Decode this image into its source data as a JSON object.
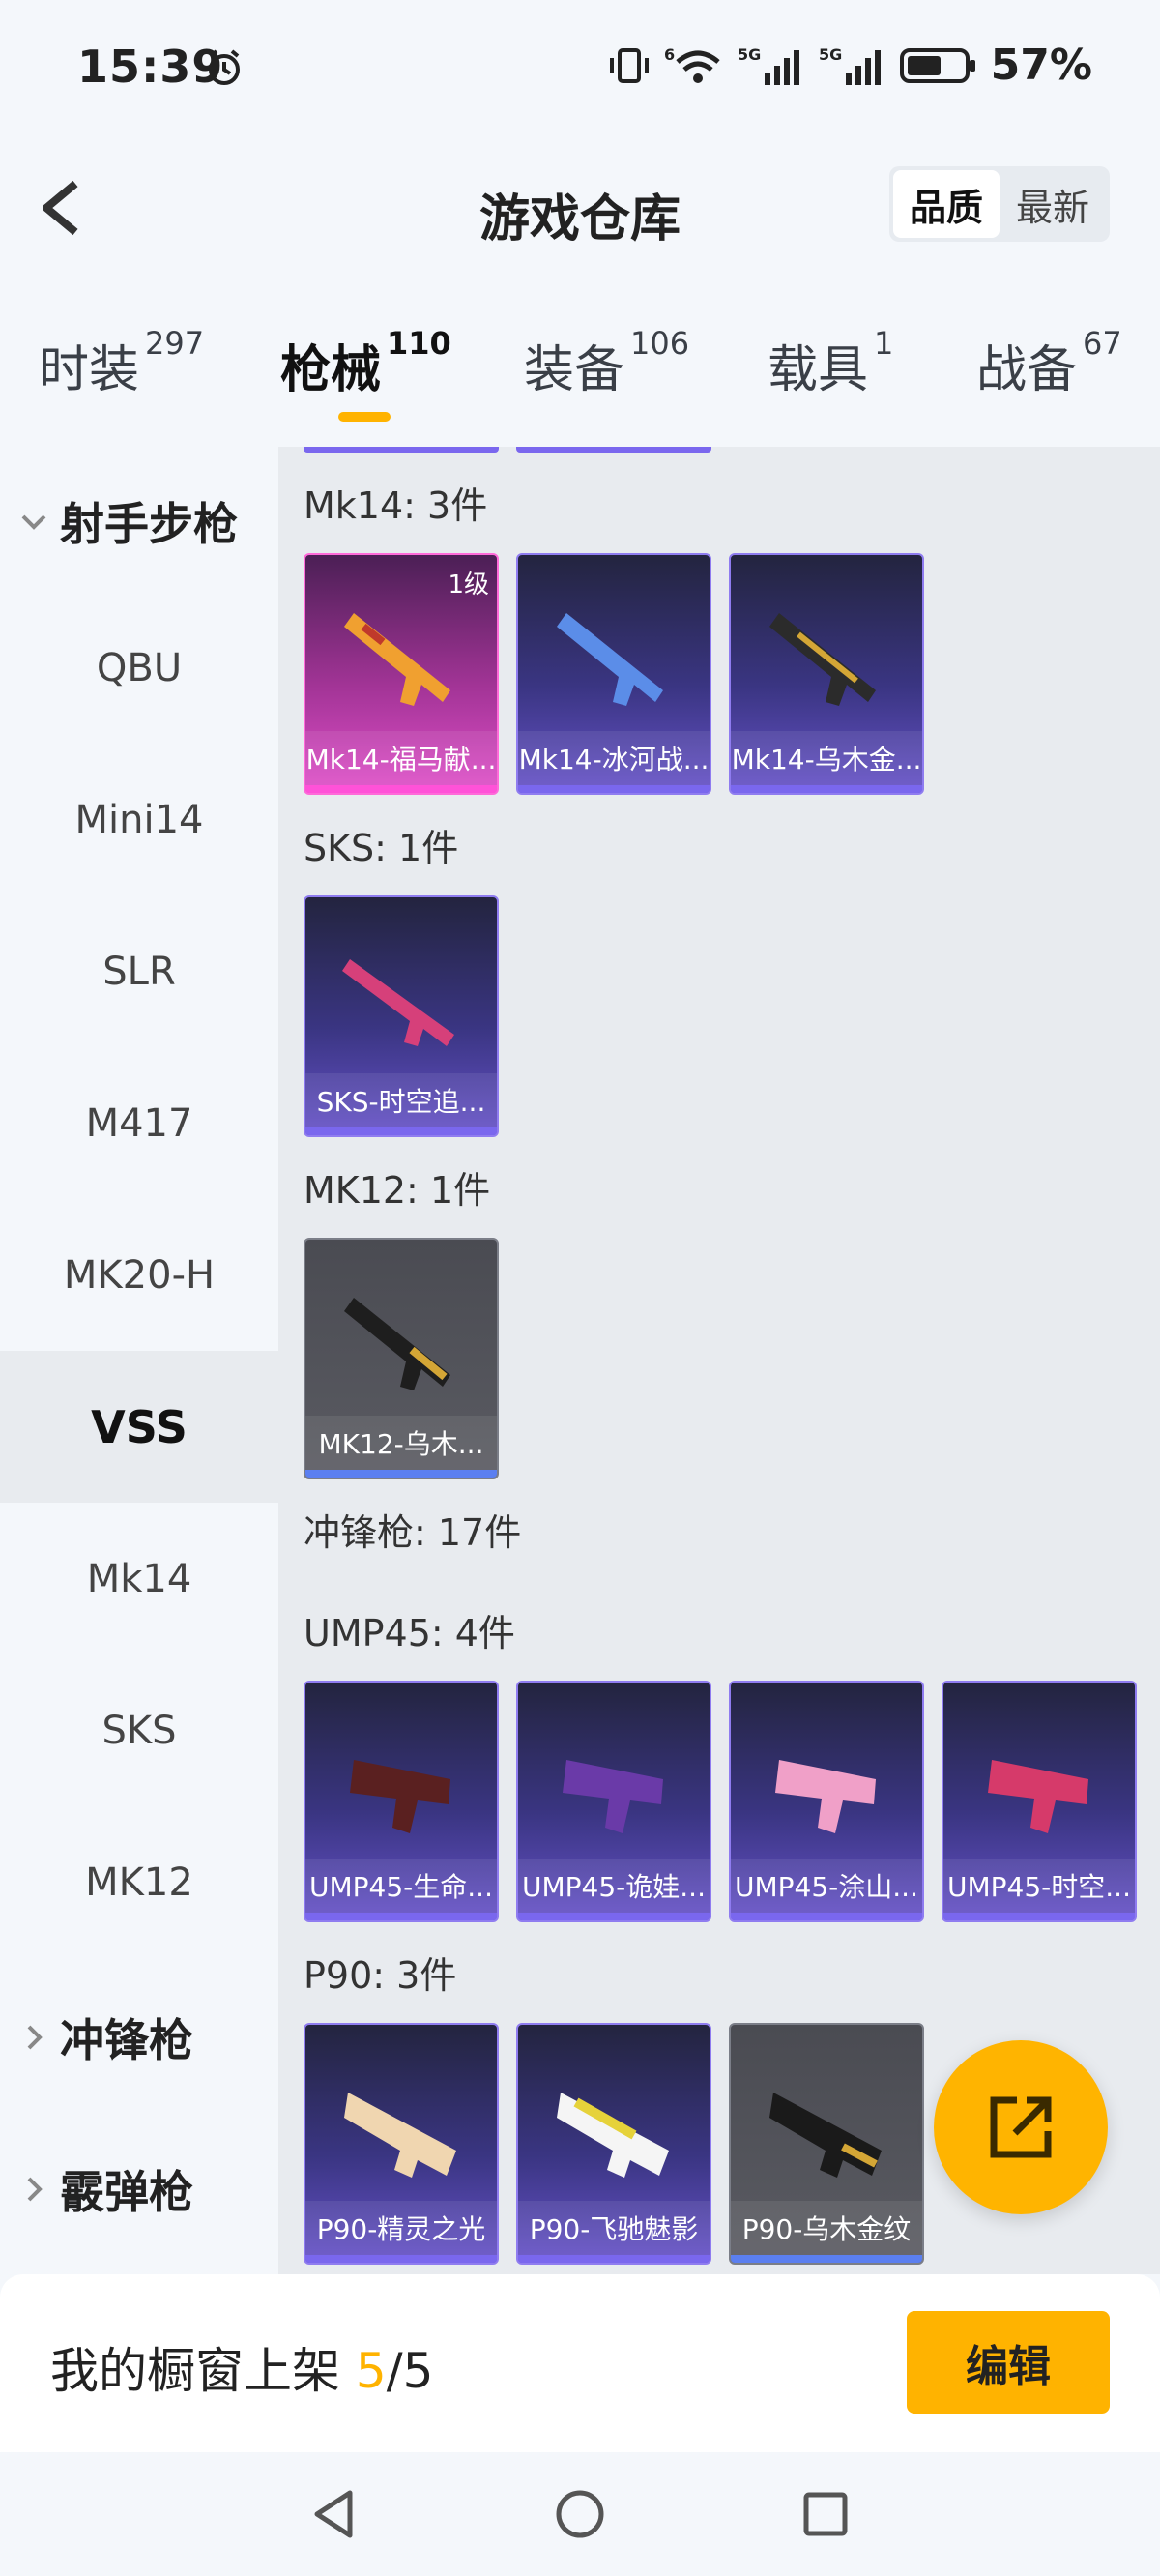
{
  "status_bar": {
    "time": "15:39",
    "network_left": "6",
    "network_5g_1": "5G",
    "network_5g_2": "5G",
    "battery": "57%"
  },
  "header": {
    "title": "游戏仓库",
    "sort_options": [
      "品质",
      "最新"
    ],
    "sort_selected": "品质"
  },
  "tabs": [
    {
      "label": "时装",
      "count": "297"
    },
    {
      "label": "枪械",
      "count": "110",
      "active": true
    },
    {
      "label": "装备",
      "count": "106"
    },
    {
      "label": "载具",
      "count": "1"
    },
    {
      "label": "战备",
      "count": "67"
    }
  ],
  "sidebar": {
    "group_open": "射手步枪",
    "items": [
      "QBU",
      "Mini14",
      "SLR",
      "M417",
      "MK20-H",
      "VSS",
      "Mk14",
      "SKS",
      "MK12"
    ],
    "active_item": "VSS",
    "group_closed_1": "冲锋枪",
    "group_closed_2": "霰弹枪"
  },
  "sections": {
    "mk14": {
      "title": "Mk14: 3件",
      "items": [
        {
          "name": "Mk14-福马献...",
          "level": "1级",
          "rarity": "pink"
        },
        {
          "name": "Mk14-冰河战...",
          "rarity": "purple"
        },
        {
          "name": "Mk14-乌木金...",
          "rarity": "purple"
        }
      ]
    },
    "sks": {
      "title": "SKS: 1件",
      "items": [
        {
          "name": "SKS-时空追...",
          "rarity": "purple"
        }
      ]
    },
    "mk12": {
      "title": "MK12: 1件",
      "items": [
        {
          "name": "MK12-乌木...",
          "rarity": "gray"
        }
      ]
    },
    "smg_header": "冲锋枪: 17件",
    "ump45": {
      "title": "UMP45: 4件",
      "items": [
        {
          "name": "UMP45-生命...",
          "rarity": "purple"
        },
        {
          "name": "UMP45-诡娃...",
          "rarity": "purple"
        },
        {
          "name": "UMP45-涂山...",
          "rarity": "purple"
        },
        {
          "name": "UMP45-时空...",
          "rarity": "purple"
        }
      ]
    },
    "p90": {
      "title": "P90: 3件",
      "items": [
        {
          "name": "P90-精灵之光",
          "rarity": "purple"
        },
        {
          "name": "P90-飞驰魅影",
          "rarity": "purple"
        },
        {
          "name": "P90-乌木金纹",
          "rarity": "gray"
        }
      ]
    }
  },
  "bottom_bar": {
    "label": "我的橱窗上架",
    "current": "5",
    "separator_total": "/5",
    "edit_label": "编辑"
  },
  "colors": {
    "accent": "#ffb300",
    "purple_rarity": "#7a67ee",
    "pink_rarity": "#ff52d8",
    "gray_rarity": "#5b7ff0"
  },
  "icons": [
    "alarm-icon",
    "vibrate-icon",
    "wifi-icon",
    "signal-icon",
    "battery-icon",
    "back-icon",
    "chevron-down-icon",
    "chevron-right-icon",
    "share-external-icon",
    "nav-back-icon",
    "nav-home-icon",
    "nav-recents-icon"
  ]
}
